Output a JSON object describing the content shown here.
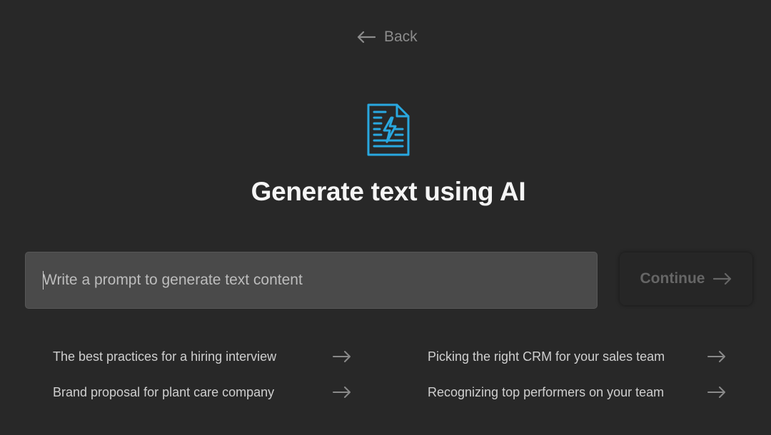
{
  "nav": {
    "back_label": "Back",
    "back_icon": "arrow-left-icon"
  },
  "hero": {
    "icon": "ai-document-icon",
    "icon_color": "#29a8e0",
    "title": "Generate text using AI"
  },
  "prompt": {
    "placeholder": "Write a prompt to generate text content",
    "value": ""
  },
  "continue_button": {
    "label": "Continue",
    "icon": "arrow-right-icon",
    "enabled": false
  },
  "suggestions": [
    {
      "label": "The best practices for a hiring interview",
      "icon": "arrow-right-icon"
    },
    {
      "label": "Brand proposal for plant care company",
      "icon": "arrow-right-icon"
    },
    {
      "label": "Picking the right CRM for your sales team",
      "icon": "arrow-right-icon"
    },
    {
      "label": "Recognizing top performers on your team",
      "icon": "arrow-right-icon"
    }
  ]
}
